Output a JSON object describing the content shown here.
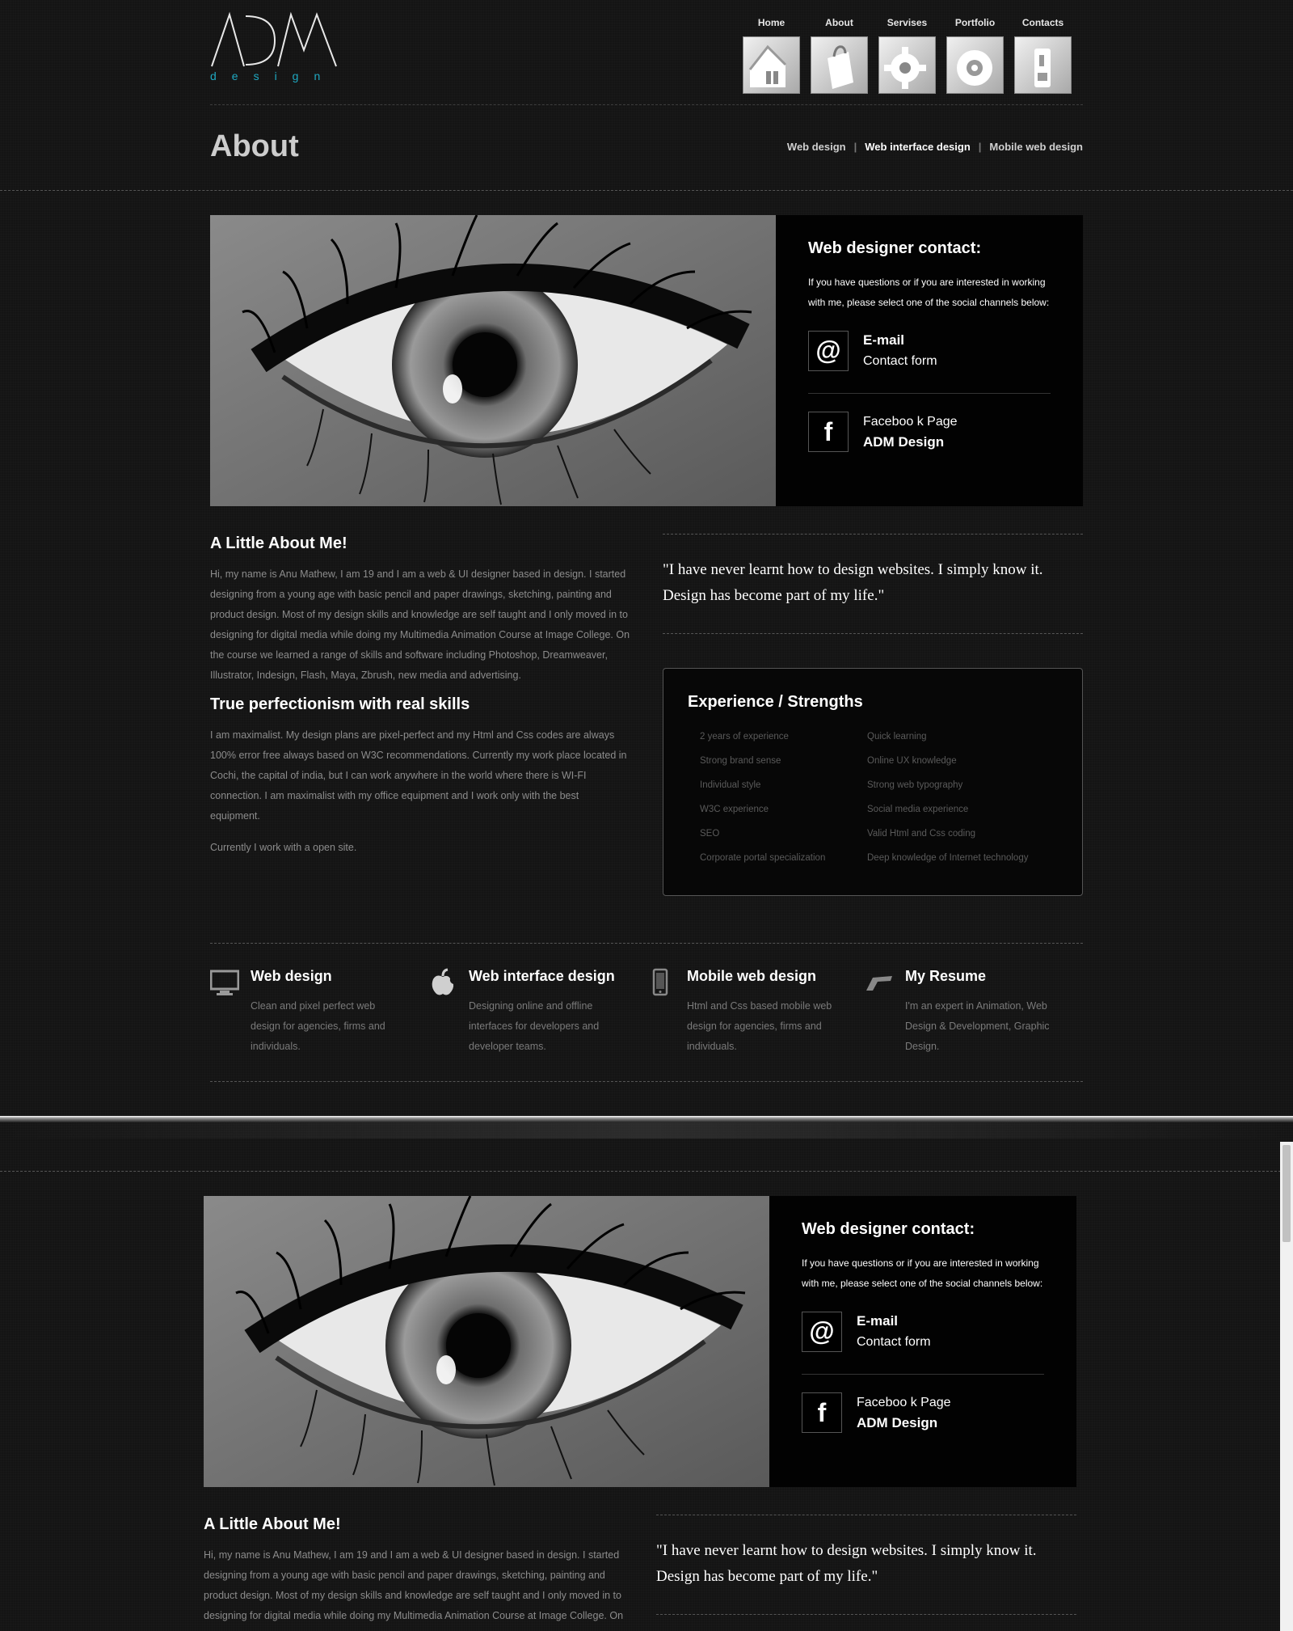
{
  "brand": {
    "logo_text": "ADM",
    "logo_sub": "design"
  },
  "nav": [
    {
      "label": "Home",
      "icon": "home-icon"
    },
    {
      "label": "About",
      "icon": "bag-icon"
    },
    {
      "label": "Servises",
      "icon": "gear-icon"
    },
    {
      "label": "Portfolio",
      "icon": "portfolio-icon"
    },
    {
      "label": "Contacts",
      "icon": "phone-icon"
    }
  ],
  "page_title": "About",
  "sub_nav": {
    "item1": "Web design",
    "item2": "Web interface design",
    "item3": "Mobile web design",
    "separator": "|"
  },
  "contact": {
    "title": "Web designer contact:",
    "intro": "If you have questions or if you are interested in working with me, please select one of the social channels below:",
    "email_icon": "@",
    "email_label": "E-mail",
    "email_sub": "Contact form",
    "fb_icon": "f",
    "fb_label": "Faceboo k Page",
    "fb_sub": "ADM Design"
  },
  "about": {
    "title": "A Little About Me!",
    "text": "Hi, my name is Anu Mathew, I am 19 and I am a web & UI designer based in design. I started designing from a young age with basic pencil and paper drawings, sketching, painting and product design. Most of my design skills and knowledge are self taught and I only moved in to designing for digital media while doing my Multimedia Animation Course at Image College. On the course we learned a range of skills and software including Photoshop, Dreamweaver, Illustrator, Indesign, Flash, Maya, Zbrush, new media and advertising.",
    "title2": "True perfectionism with real skills",
    "text2": "I am maximalist. My design plans are pixel-perfect and my Html and Css codes are always 100% error free always based on W3C recommendations. Currently my work place located in Cochi, the capital of india, but I can work anywhere in the world where there is WI-FI connection. I am maximalist with my office equipment and I work only with the best equipment.",
    "text3": "Currently I work with a open site."
  },
  "quote": "\"I have never learnt how to design websites. I simply know it. Design has become part of my life.\"",
  "experience": {
    "title": "Experience / Strengths",
    "items": [
      "2 years of experience",
      "Quick learning",
      "Strong brand sense",
      "Online UX knowledge",
      "Individual style",
      "Strong web typography",
      "W3C experience",
      "Social media experience",
      "SEO",
      "Valid Html and Css coding",
      "Corporate portal specialization",
      "Deep knowledge of Internet technology"
    ]
  },
  "services": [
    {
      "title": "Web design",
      "text": "Clean and pixel perfect web design for agencies, firms and individuals.",
      "icon": "monitor-icon"
    },
    {
      "title": "Web interface design",
      "text": "Designing online and offline interfaces for developers and developer teams.",
      "icon": "apple-icon"
    },
    {
      "title": "Mobile web design",
      "text": "Html and Css based mobile web design for agencies, firms and individuals.",
      "icon": "mobile-icon"
    },
    {
      "title": "My Resume",
      "text": "I'm an expert in Animation, Web Design & Development, Graphic Design.",
      "icon": "resume-icon"
    }
  ]
}
